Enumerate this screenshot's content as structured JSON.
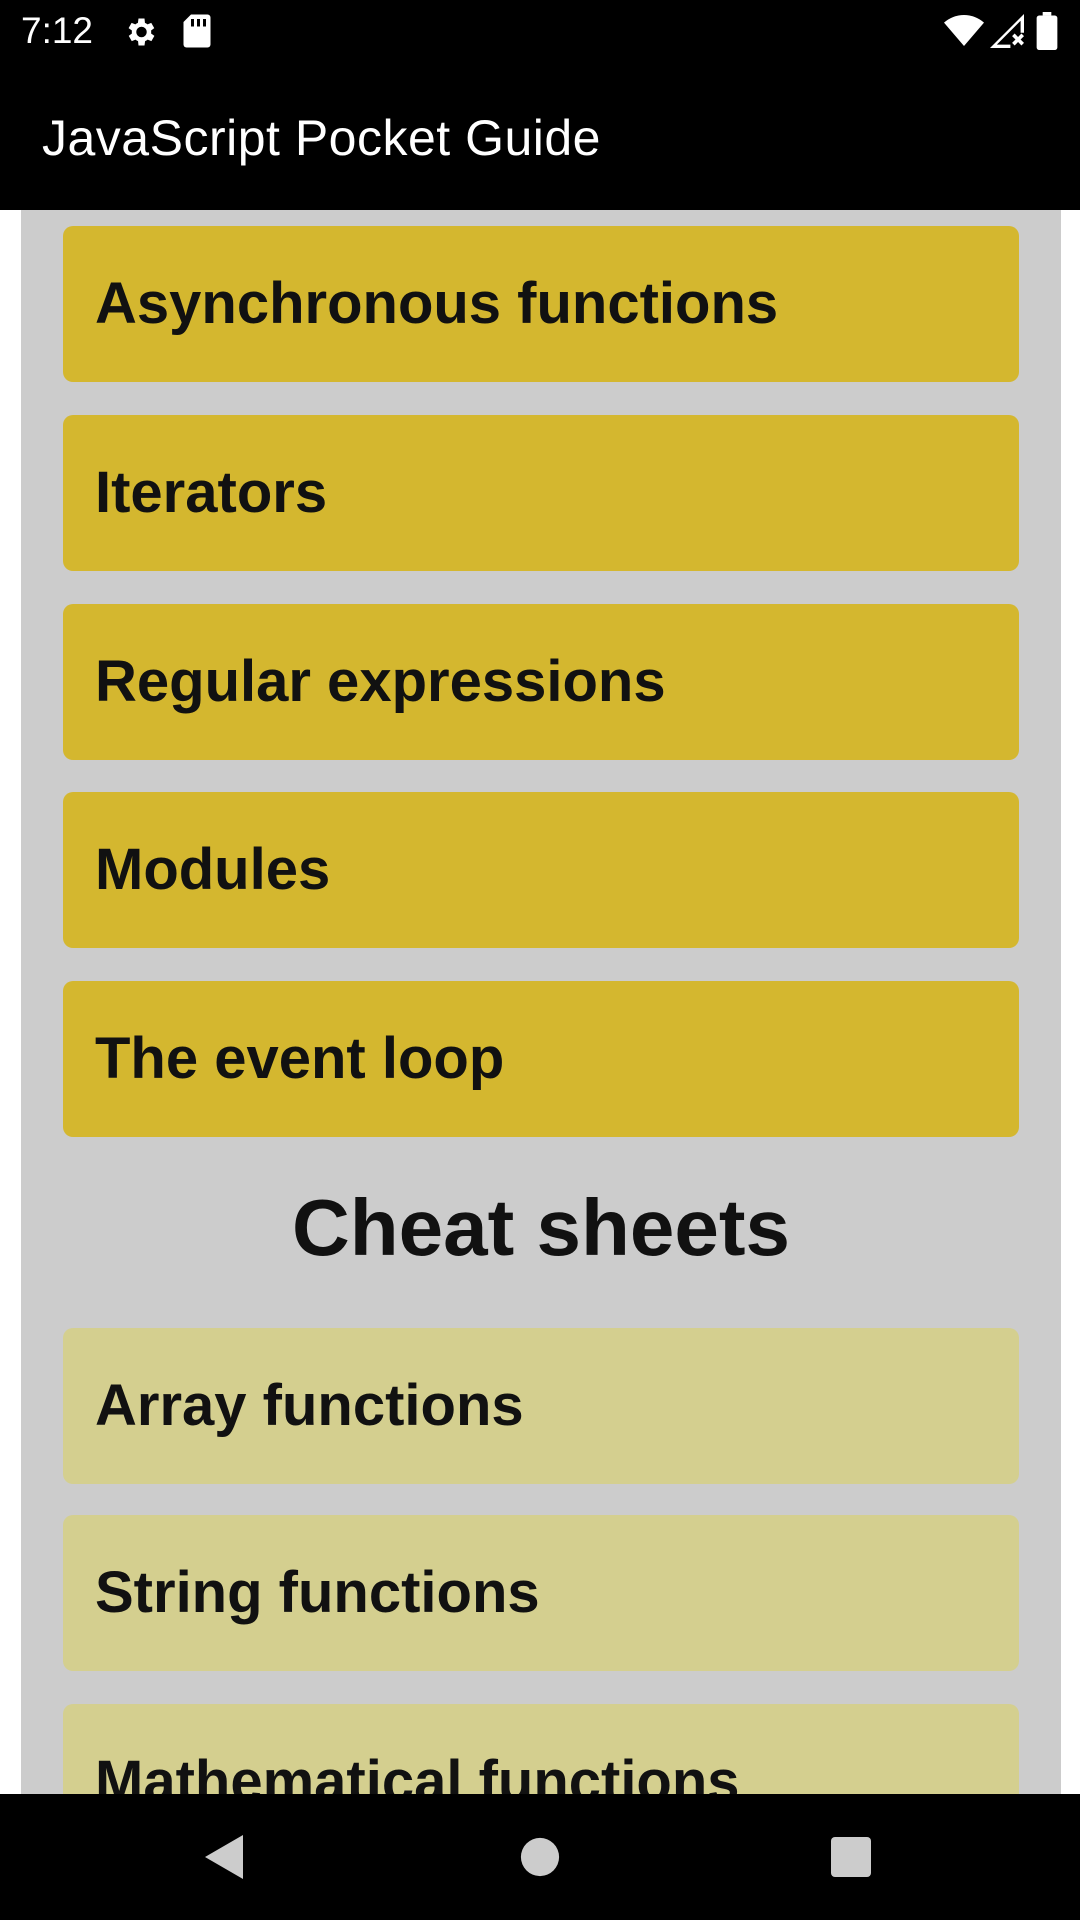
{
  "status_bar": {
    "time": "7:12",
    "icons": [
      "gear-icon",
      "sd-card-icon",
      "wifi-icon",
      "signal-icon",
      "battery-icon"
    ]
  },
  "app_bar": {
    "title": "JavaScript Pocket Guide"
  },
  "topics": [
    {
      "label": "Asynchronous functions"
    },
    {
      "label": "Iterators"
    },
    {
      "label": "Regular expressions"
    },
    {
      "label": "Modules"
    },
    {
      "label": "The event loop"
    }
  ],
  "cheat_sheets": {
    "heading": "Cheat sheets",
    "items": [
      {
        "label": "Array functions"
      },
      {
        "label": "String functions"
      },
      {
        "label": "Mathematical functions"
      }
    ]
  },
  "nav_bar": {
    "icons": [
      "back-icon",
      "home-icon",
      "recents-icon"
    ]
  },
  "colors": {
    "topic_card": "#d4b72f",
    "cheat_card": "#d4cf8f",
    "panel": "#cccccc",
    "bars": "#000000"
  }
}
